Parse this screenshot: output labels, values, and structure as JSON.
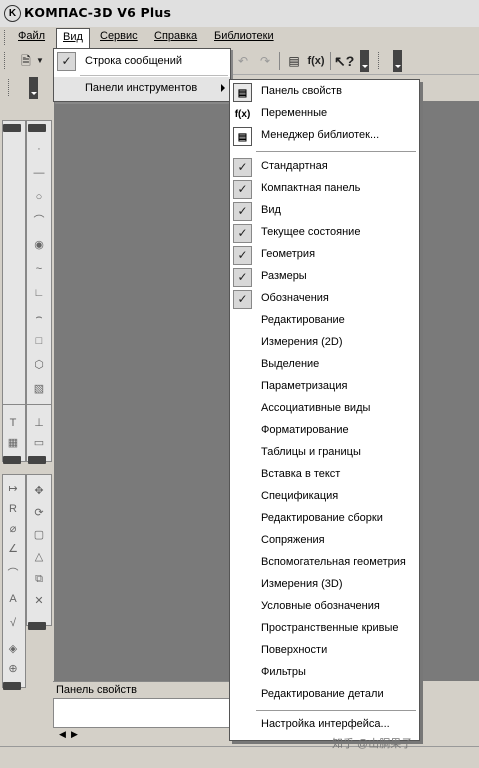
{
  "window": {
    "title": "КОМПАС-3D V6 Plus",
    "logo_icon": "kompas-logo-icon"
  },
  "menubar": [
    {
      "label": "Файл"
    },
    {
      "label": "Вид",
      "active": true
    },
    {
      "label": "Сервис"
    },
    {
      "label": "Справка"
    },
    {
      "label": "Библиотеки"
    }
  ],
  "toolbar": {
    "fx_label": "f(x)",
    "help_label": "?"
  },
  "view_menu": {
    "items": [
      {
        "label": "Строка сообщений",
        "checked": true
      },
      {
        "label": "Панели инструментов",
        "submenu": true,
        "highlighted": true
      }
    ]
  },
  "toolbars_submenu": {
    "top_items": [
      {
        "label": "Панель свойств",
        "icon": "properties-panel-icon"
      },
      {
        "label": "Переменные",
        "icon": "variables-fx-icon",
        "icon_text": "f(x)"
      },
      {
        "label": "Менеджер библиотек...",
        "icon": "library-manager-icon"
      }
    ],
    "items": [
      {
        "label": "Стандартная",
        "checked": true
      },
      {
        "label": "Компактная панель",
        "checked": true
      },
      {
        "label": "Вид",
        "checked": true
      },
      {
        "label": "Текущее состояние",
        "checked": true
      },
      {
        "label": "Геометрия",
        "checked": true
      },
      {
        "label": "Размеры",
        "checked": true
      },
      {
        "label": "Обозначения",
        "checked": true
      },
      {
        "label": "Редактирование",
        "checked": false
      },
      {
        "label": "Измерения (2D)",
        "checked": false
      },
      {
        "label": "Выделение",
        "checked": false
      },
      {
        "label": "Параметризация",
        "checked": false
      },
      {
        "label": "Ассоциативные виды",
        "checked": false
      },
      {
        "label": "Форматирование",
        "checked": false
      },
      {
        "label": "Таблицы и границы",
        "checked": false
      },
      {
        "label": "Вставка в текст",
        "checked": false
      },
      {
        "label": "Спецификация",
        "checked": false
      },
      {
        "label": "Редактирование сборки",
        "checked": false
      },
      {
        "label": "Сопряжения",
        "checked": false
      },
      {
        "label": "Вспомогательная геометрия",
        "checked": false
      },
      {
        "label": "Измерения (3D)",
        "checked": false
      },
      {
        "label": "Условные обозначения",
        "checked": false
      },
      {
        "label": "Пространственные кривые",
        "checked": false
      },
      {
        "label": "Поверхности",
        "checked": false
      },
      {
        "label": "Фильтры",
        "checked": false
      },
      {
        "label": "Редактирование детали",
        "checked": false
      }
    ],
    "footer_item": {
      "label": "Настройка интерфейса..."
    }
  },
  "property_panel": {
    "title": "Панель свойств"
  },
  "watermark": "知乎 @山胴果子",
  "colors": {
    "workspace": "#7a7a7a",
    "menu_bg": "#ffffff",
    "check_bg": "#d8d8d8"
  }
}
